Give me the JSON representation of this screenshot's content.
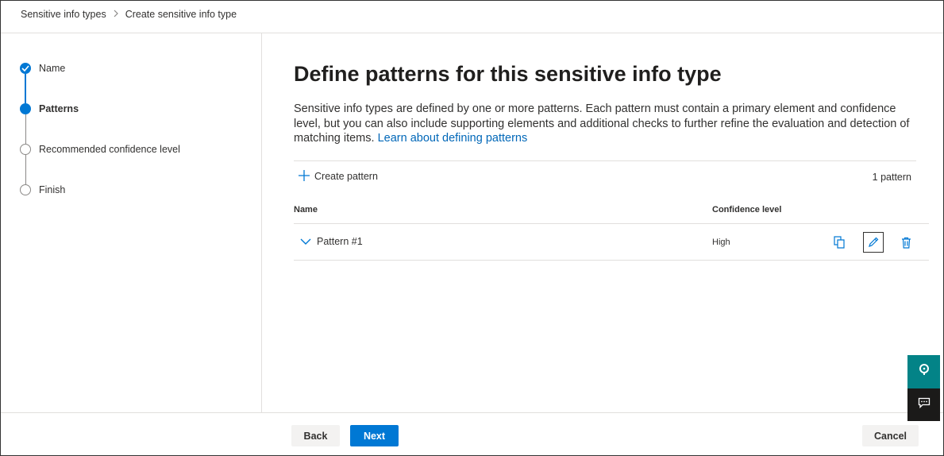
{
  "breadcrumb": {
    "items": [
      "Sensitive info types",
      "Create sensitive info type"
    ]
  },
  "steps": [
    {
      "label": "Name",
      "state": "done"
    },
    {
      "label": "Patterns",
      "state": "current"
    },
    {
      "label": "Recommended confidence level",
      "state": "todo"
    },
    {
      "label": "Finish",
      "state": "todo"
    }
  ],
  "main": {
    "title": "Define patterns for this sensitive info type",
    "description": "Sensitive info types are defined by one or more patterns. Each pattern must contain a primary element and confidence level, but you can also include supporting elements and additional checks to further refine the evaluation and detection of matching items.",
    "learn_link": "Learn about defining patterns",
    "create_pattern_label": "Create pattern",
    "pattern_count": "1 pattern",
    "table": {
      "headers": [
        "Name",
        "Confidence level"
      ],
      "rows": [
        {
          "name": "Pattern #1",
          "confidence": "High"
        }
      ]
    }
  },
  "footer": {
    "back_label": "Back",
    "next_label": "Next",
    "cancel_label": "Cancel"
  },
  "icons": {
    "step_done": "checkmark-icon",
    "row_expand": "chevron-down-icon",
    "copy": "copy-icon",
    "edit": "pencil-icon",
    "delete": "trash-icon",
    "help": "help-icon",
    "feedback": "feedback-icon"
  },
  "colors": {
    "accent": "#0078d4",
    "link": "#0067b8",
    "help_bg": "#038387",
    "feedback_bg": "#1b1a19"
  }
}
